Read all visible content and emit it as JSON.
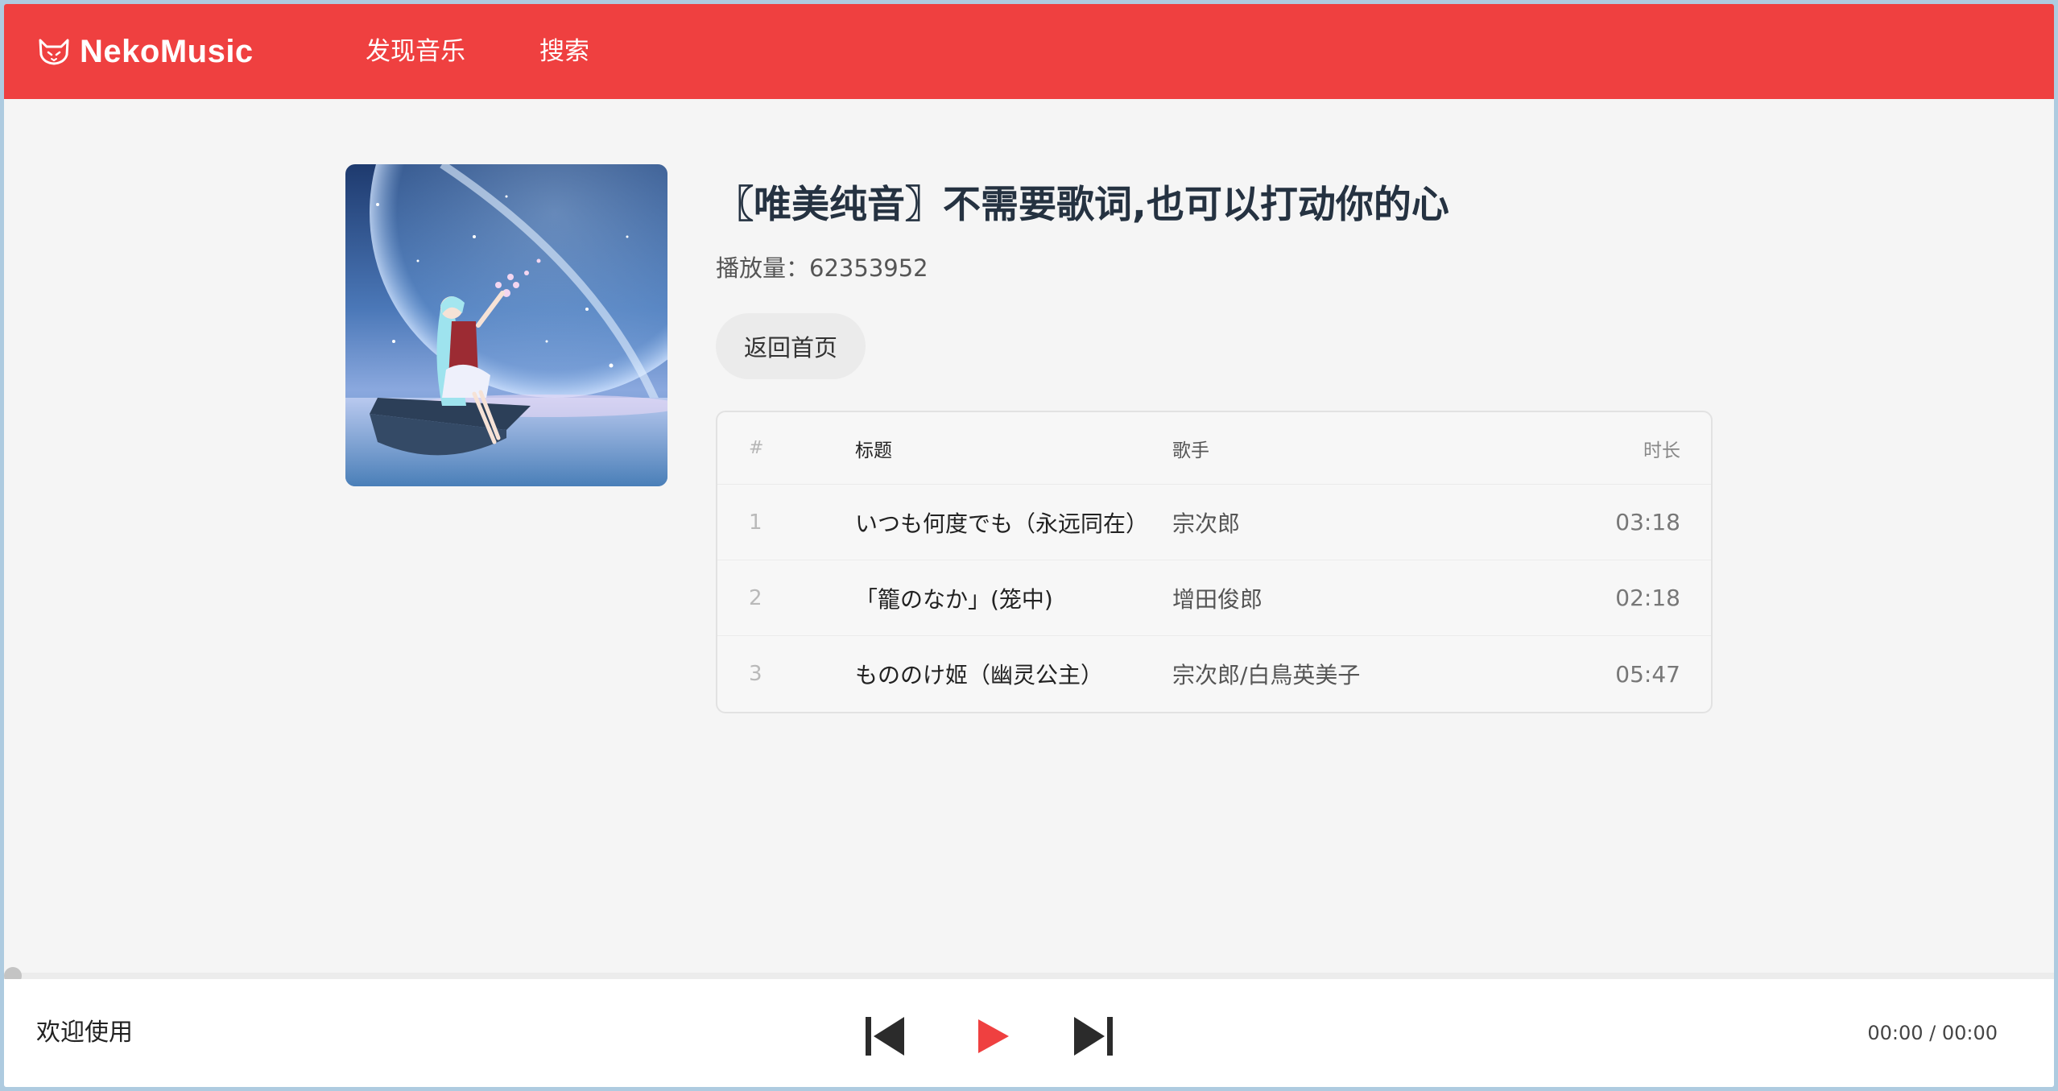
{
  "app": {
    "name": "NekoMusic",
    "logo_icon": "cat-logo-icon"
  },
  "nav": [
    {
      "label": "发现音乐"
    },
    {
      "label": "搜索"
    }
  ],
  "playlist": {
    "title": "〖唯美纯音〗不需要歌词,也可以打动你的心",
    "play_count_label": "播放量：",
    "play_count": "62353952",
    "back_label": "返回首页"
  },
  "table": {
    "headers": {
      "num": "#",
      "title": "标题",
      "artist": "歌手",
      "duration": "时长"
    },
    "tracks": [
      {
        "num": "1",
        "title": "いつも何度でも（永远同在）",
        "artist": "宗次郎",
        "duration": "03:18"
      },
      {
        "num": "2",
        "title": "「籠のなか」(笼中)",
        "artist": "增田俊郎",
        "duration": "02:18"
      },
      {
        "num": "3",
        "title": "もののけ姬（幽灵公主）",
        "artist": "宗次郎/白鳥英美子",
        "duration": "05:47"
      }
    ]
  },
  "player": {
    "now_playing": "欢迎使用",
    "time": "00:00 / 00:00",
    "progress": 0,
    "icons": {
      "prev": "skip-previous-icon",
      "play": "play-icon",
      "next": "skip-next-icon"
    }
  },
  "colors": {
    "brand": "#ef4040",
    "title": "#253241",
    "background": "#f5f5f5"
  }
}
